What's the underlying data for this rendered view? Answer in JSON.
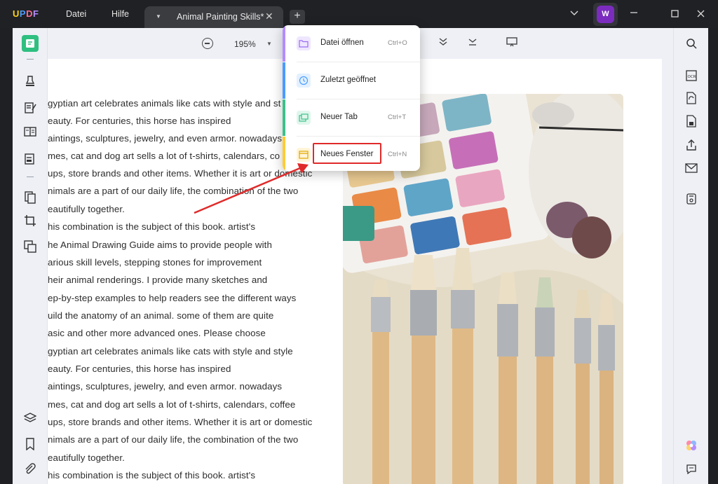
{
  "app": {
    "logo": "UPDF",
    "menu": [
      "Datei",
      "Hilfe"
    ],
    "tab_title": "Animal Painting Skills*",
    "avatar_letter": "W"
  },
  "toolbar": {
    "zoom": "195%"
  },
  "dropdown": {
    "items": [
      {
        "label": "Datei öffnen",
        "shortcut": "Ctrl+O",
        "color": "#b48cff"
      },
      {
        "label": "Zuletzt geöffnet",
        "shortcut": "",
        "color": "#4a9cff"
      },
      {
        "label": "Neuer Tab",
        "shortcut": "Ctrl+T",
        "color": "#3cc08a"
      },
      {
        "label": "Neues Fenster",
        "shortcut": "Ctrl+N",
        "color": "#ffcc33"
      }
    ]
  },
  "document": {
    "lines": [
      "gyptian art celebrates animals like cats with style and st",
      "eauty. For centuries, this horse has inspired",
      "aintings, sculptures, jewelry, and even armor. nowadays",
      "mes, cat and dog art sells a lot of t-shirts, calendars, co",
      "ups, store brands and other items. Whether it is art or domestic",
      "nimals are a part of our daily life, the combination of the two",
      "eautifully together.",
      "his combination is the subject of this book. artist's",
      "he Animal Drawing Guide aims to provide people with",
      "arious skill levels, stepping stones for improvement",
      "heir animal renderings. I provide many sketches and",
      "ep-by-step examples to help readers see the different ways",
      "uild the anatomy of an animal. some of them are quite",
      "asic and other more advanced ones. Please choose",
      "gyptian art celebrates animals like cats with style and style",
      "eauty. For centuries, this horse has inspired",
      "aintings, sculptures, jewelry, and even armor. nowadays",
      "mes, cat and dog art sells a lot of t-shirts, calendars, coffee",
      "ups, store brands and other items. Whether it is art or domestic",
      "nimals are a part of our daily life, the combination of the two",
      "eautifully together.",
      "his combination is the subject of this book. artist's"
    ]
  }
}
